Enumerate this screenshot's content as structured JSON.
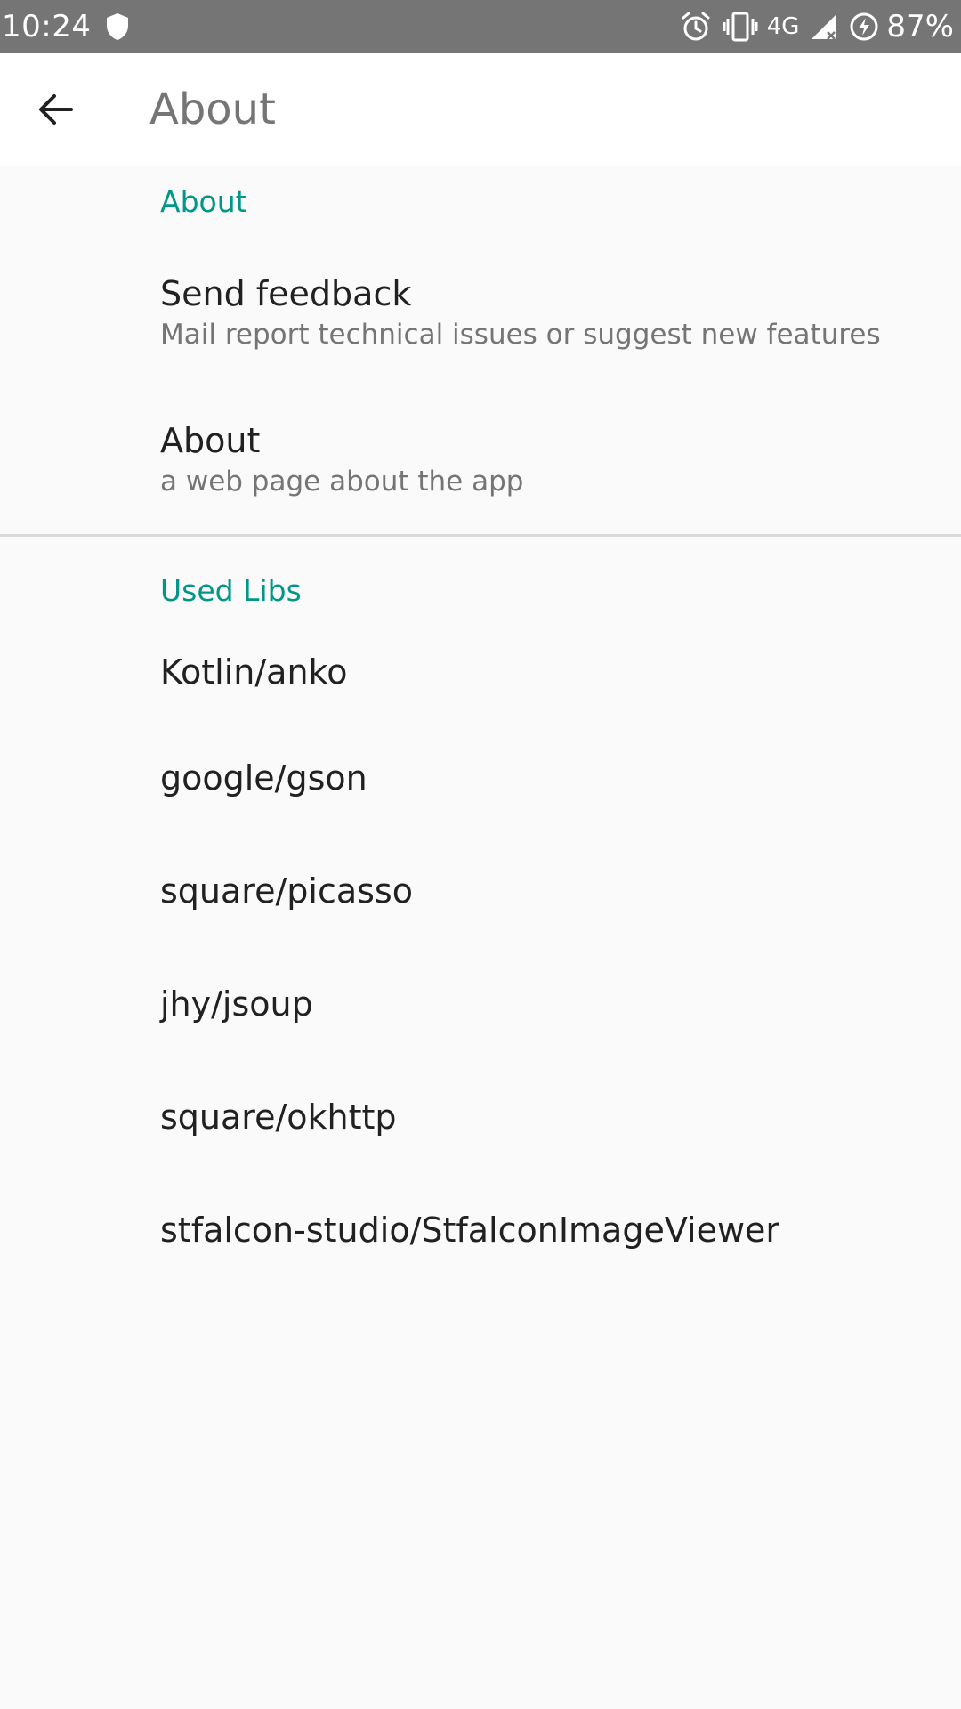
{
  "status_bar": {
    "time": "10:24",
    "network": "4G",
    "battery": "87%",
    "icons": [
      "shield-icon",
      "alarm-icon",
      "vibrate-icon",
      "signal-icon",
      "battery-charging-icon"
    ]
  },
  "app_bar": {
    "title": "About",
    "back_icon": "arrow-back-icon"
  },
  "sections": [
    {
      "header": "About",
      "items": [
        {
          "title": "Send feedback",
          "summary": "Mail report technical issues or suggest new features"
        },
        {
          "title": "About",
          "summary": "a web page about the app"
        }
      ]
    },
    {
      "header": "Used Libs",
      "items": [
        {
          "title": "Kotlin/anko"
        },
        {
          "title": "google/gson"
        },
        {
          "title": "square/picasso"
        },
        {
          "title": "jhy/jsoup"
        },
        {
          "title": "square/okhttp"
        },
        {
          "title": "stfalcon-studio/StfalconImageViewer"
        }
      ]
    }
  ],
  "colors": {
    "accent": "#009688",
    "status_bar": "#757575",
    "background": "#fafafa",
    "app_bar": "#ffffff"
  }
}
